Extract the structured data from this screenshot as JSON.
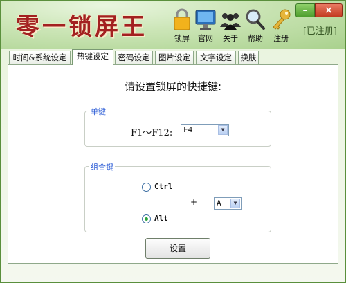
{
  "app": {
    "logo": "零一锁屏王",
    "registered_status": "[已注册]"
  },
  "toolbar": [
    {
      "label": "锁屏",
      "icon": "padlock-icon"
    },
    {
      "label": "官网",
      "icon": "monitor-icon"
    },
    {
      "label": "关于",
      "icon": "people-icon"
    },
    {
      "label": "帮助",
      "icon": "magnifier-icon"
    },
    {
      "label": "注册",
      "icon": "key-icon"
    }
  ],
  "window_controls": {
    "minimize": "–",
    "close": "×"
  },
  "tabs": [
    {
      "label": "时间&系统设定",
      "active": false
    },
    {
      "label": "热键设定",
      "active": true
    },
    {
      "label": "密码设定",
      "active": false
    },
    {
      "label": "图片设定",
      "active": false
    },
    {
      "label": "文字设定",
      "active": false
    },
    {
      "label": "换肤",
      "active": false
    }
  ],
  "hotkey": {
    "heading": "请设置锁屏的快捷键:",
    "single": {
      "title": "单键",
      "label": "F1～F12:",
      "value": "F4"
    },
    "combo": {
      "title": "组合键",
      "modifier_ctrl": "Ctrl",
      "modifier_alt": "Alt",
      "selected_modifier": "Alt",
      "plus": "+",
      "key_value": "A"
    },
    "confirm_button": "设置"
  },
  "colors": {
    "logo": "#a32020",
    "group_title": "#2a5bd6",
    "radio_selected": "#2aa43a",
    "close_button": "#c23a20"
  }
}
